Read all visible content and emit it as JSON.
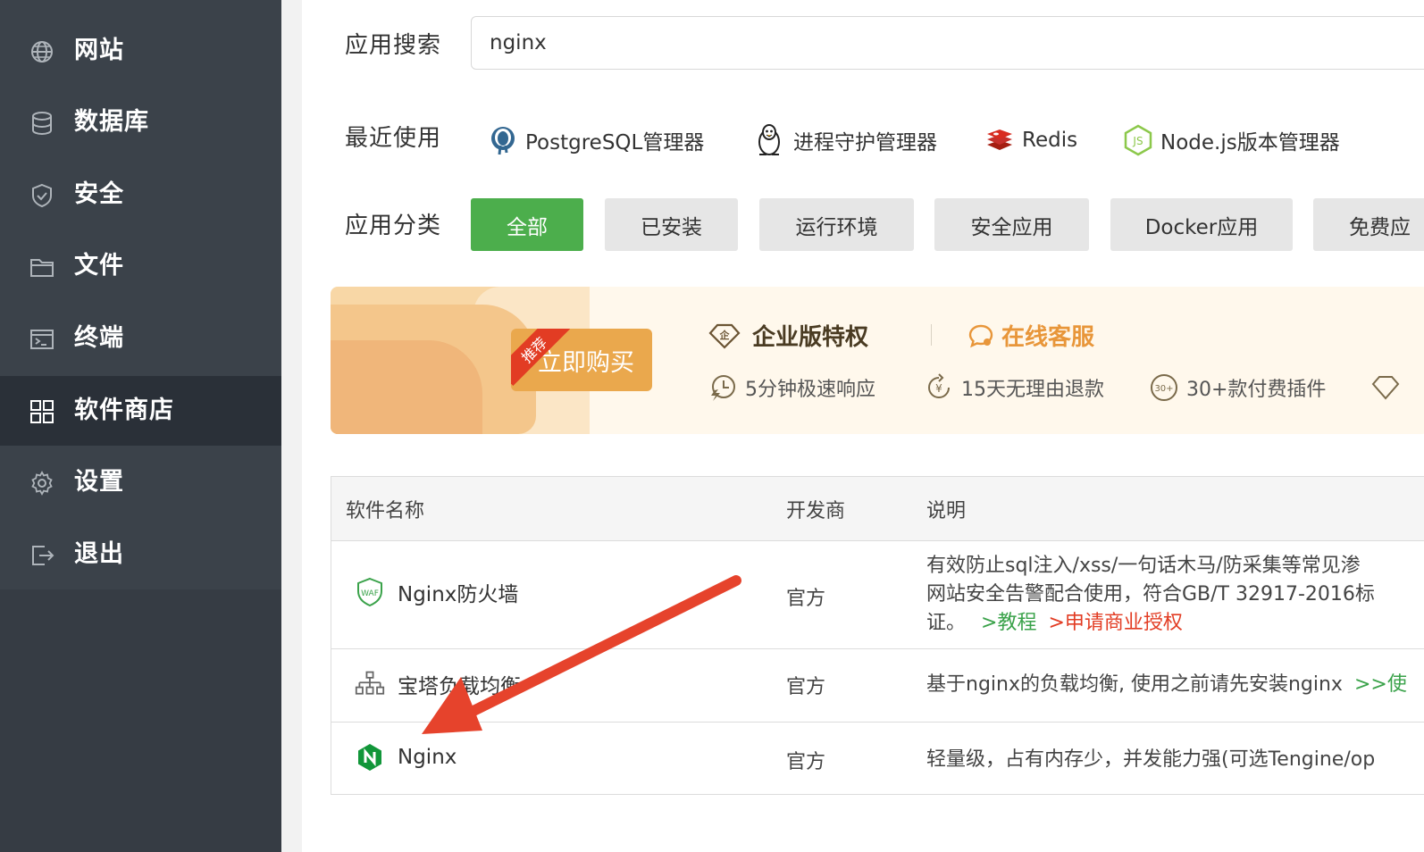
{
  "sidebar": {
    "items": [
      {
        "label": "网站",
        "icon": "globe-icon"
      },
      {
        "label": "数据库",
        "icon": "database-icon"
      },
      {
        "label": "安全",
        "icon": "shield-icon"
      },
      {
        "label": "文件",
        "icon": "folder-icon"
      },
      {
        "label": "终端",
        "icon": "terminal-icon"
      },
      {
        "label": "软件商店",
        "icon": "grid-icon",
        "active": true
      },
      {
        "label": "设置",
        "icon": "gear-icon"
      },
      {
        "label": "退出",
        "icon": "logout-icon"
      }
    ]
  },
  "search": {
    "label": "应用搜索",
    "value": "nginx"
  },
  "recent": {
    "label": "最近使用",
    "items": [
      {
        "label": "PostgreSQL管理器",
        "icon": "postgresql-icon"
      },
      {
        "label": "进程守护管理器",
        "icon": "penguin-icon"
      },
      {
        "label": "Redis",
        "icon": "redis-icon"
      },
      {
        "label": "Node.js版本管理器",
        "icon": "nodejs-icon"
      }
    ]
  },
  "categories": {
    "label": "应用分类",
    "items": [
      "全部",
      "已安装",
      "运行环境",
      "安全应用",
      "Docker应用",
      "免费应"
    ],
    "active_index": 0
  },
  "banner": {
    "buy_button": "立即购买",
    "ribbon": "推荐",
    "enterprise_title": "企业版特权",
    "support_title": "在线客服",
    "perks": [
      "5分钟极速响应",
      "15天无理由退款",
      "30+款付费插件"
    ]
  },
  "table": {
    "headers": [
      "软件名称",
      "开发商",
      "说明"
    ],
    "rows": [
      {
        "name": "Nginx防火墙",
        "developer": "官方",
        "desc_line1": "有效防止sql注入/xss/一句话木马/防采集等常见渗",
        "desc_line2": "网站安全告警配合使用，符合GB/T 32917-2016标",
        "desc_line3": "证。",
        "link_tutorial": ">教程",
        "link_license": ">申请商业授权"
      },
      {
        "name": "宝塔负载均衡",
        "developer": "官方",
        "desc_line1": "基于nginx的负载均衡, 使用之前请先安装nginx",
        "link_more": ">>使"
      },
      {
        "name": "Nginx",
        "developer": "官方",
        "desc_line1": "轻量级，占有内存少，并发能力强(可选Tengine/op"
      }
    ]
  },
  "colors": {
    "sidebar_bg": "#3b424a",
    "sidebar_active": "#2a3038",
    "accent_green": "#4cae4c",
    "banner_orange": "#eaa84d",
    "support_orange": "#e8963a",
    "arrow_red": "#e6432c"
  }
}
